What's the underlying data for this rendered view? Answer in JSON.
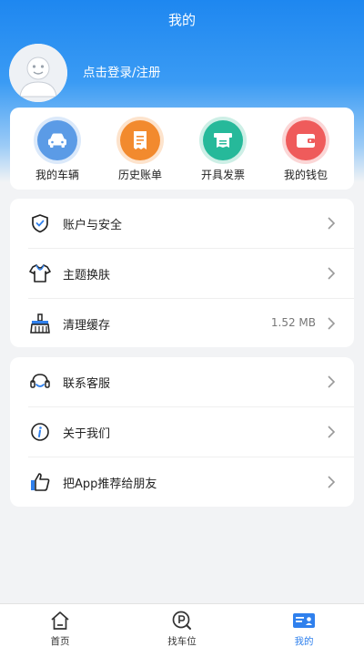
{
  "header": {
    "title": "我的"
  },
  "user": {
    "login_label": "点击登录/注册"
  },
  "quick_actions": [
    {
      "label": "我的车辆",
      "icon": "car-icon",
      "color": "#4a90e2"
    },
    {
      "label": "历史账单",
      "icon": "bill-icon",
      "color": "#f28a2e"
    },
    {
      "label": "开具发票",
      "icon": "invoice-icon",
      "color": "#26b99a"
    },
    {
      "label": "我的钱包",
      "icon": "wallet-icon",
      "color": "#ef5b5b"
    }
  ],
  "settings_group_1": [
    {
      "label": "账户与安全",
      "icon": "shield-icon",
      "value": ""
    },
    {
      "label": "主题换肤",
      "icon": "shirt-icon",
      "value": ""
    },
    {
      "label": "清理缓存",
      "icon": "broom-icon",
      "value": "1.52 MB"
    }
  ],
  "settings_group_2": [
    {
      "label": "联系客服",
      "icon": "headset-icon",
      "value": ""
    },
    {
      "label": "关于我们",
      "icon": "info-icon",
      "value": ""
    },
    {
      "label": "把App推荐给朋友",
      "icon": "thumbs-up-icon",
      "value": ""
    }
  ],
  "tabbar": {
    "tabs": [
      {
        "label": "首页",
        "icon": "home-icon"
      },
      {
        "label": "找车位",
        "icon": "parking-search-icon"
      },
      {
        "label": "我的",
        "icon": "profile-card-icon"
      }
    ],
    "active_index": 2
  },
  "colors": {
    "primary": "#1e87f0",
    "active_tab": "#2f80ed"
  }
}
